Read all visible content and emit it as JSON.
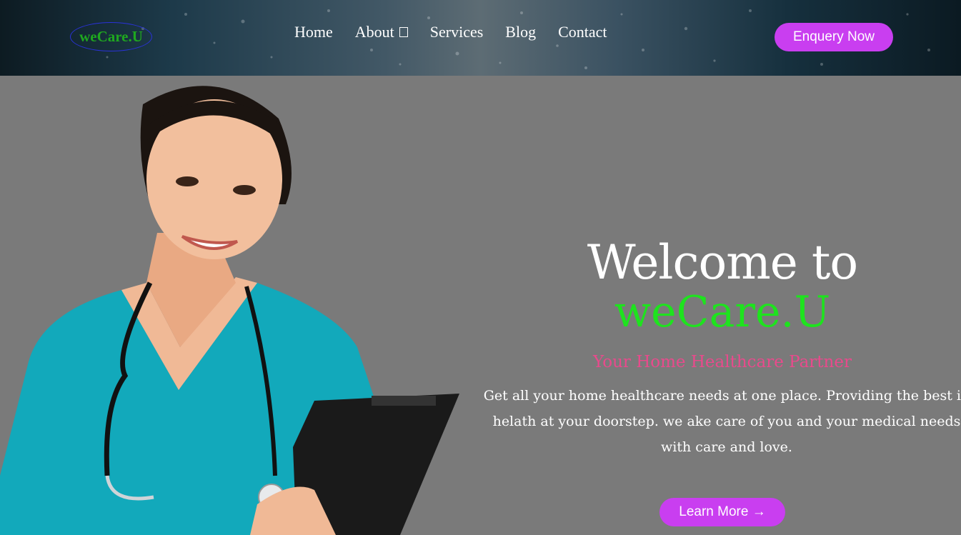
{
  "header": {
    "logo_text": "weCare.U",
    "nav": [
      "Home",
      "About",
      "Services",
      "Blog",
      "Contact"
    ],
    "cta_label": "Enquery Now"
  },
  "hero": {
    "welcome": "Welcome to",
    "brand": "weCare.U",
    "tagline": "Your Home Healthcare Partner",
    "description": "Get all your home healthcare needs at one place. Providing the best in helath at your doorstep. we ake care of you and your medical needs with care and love.",
    "cta_label": "Learn More →"
  },
  "colors": {
    "accent": "#c93ef0",
    "brand_green": "#1ee31e",
    "tagline_pink": "#e94a8c",
    "background": "#7a7a7a"
  },
  "icons": {
    "about_dropdown": "chevron-down-icon"
  }
}
